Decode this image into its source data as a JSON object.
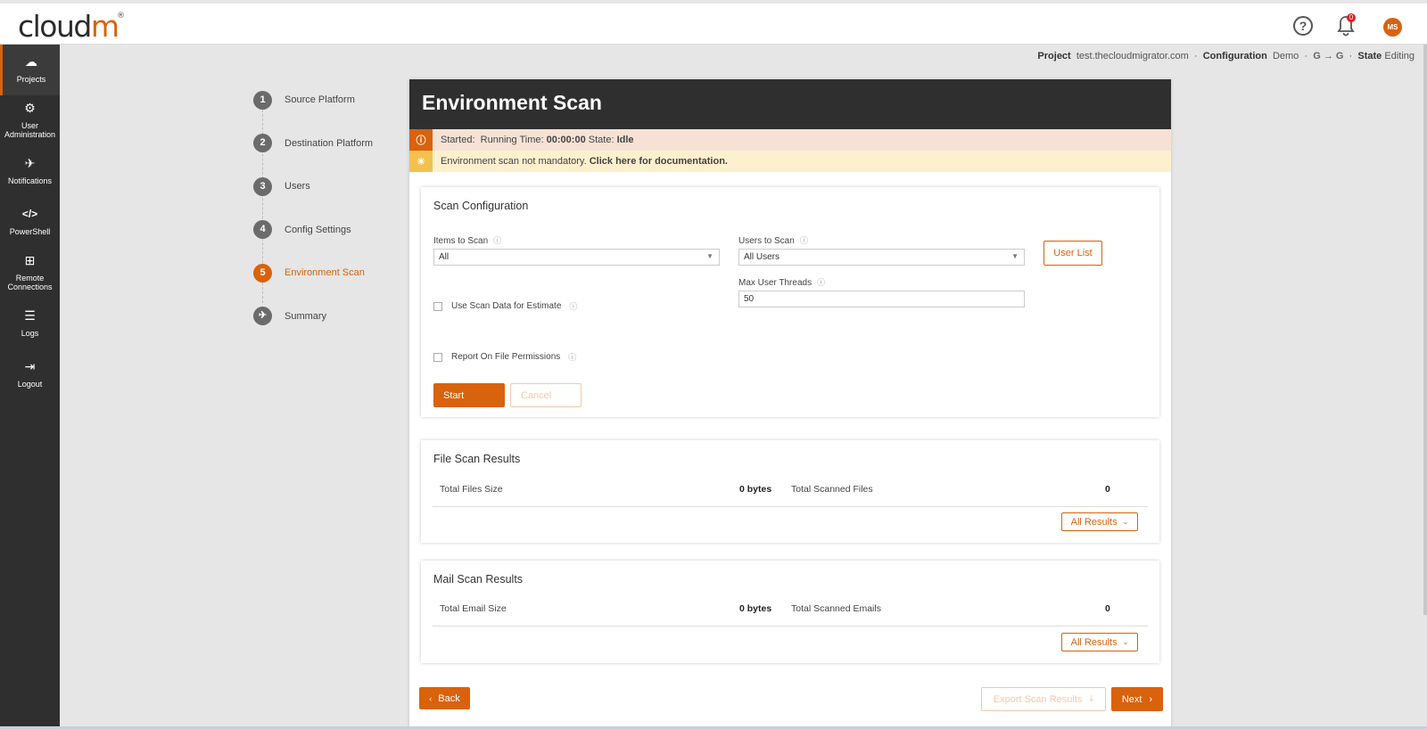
{
  "app": {
    "logo_text": "cloud",
    "logo_accent": "m",
    "logo_reg": "®",
    "avatar_initials": "MS",
    "notification_count": "0",
    "brand_color": "#d9620c"
  },
  "sidebar": {
    "items": [
      {
        "label": "Projects",
        "icon": "cloud-icon",
        "glyph": "☁"
      },
      {
        "label": "User Administration",
        "icon": "gear-icon",
        "glyph": "⚙"
      },
      {
        "label": "Notifications",
        "icon": "paper-plane-icon",
        "glyph": "✈"
      },
      {
        "label": "PowerShell",
        "icon": "code-icon",
        "glyph": "</>"
      },
      {
        "label": "Remote Connections",
        "icon": "sitemap-icon",
        "glyph": "⊞"
      },
      {
        "label": "Logs",
        "icon": "list-icon",
        "glyph": "☰"
      },
      {
        "label": "Logout",
        "icon": "logout-icon",
        "glyph": "⇥"
      }
    ]
  },
  "breadcrumb": {
    "project_label": "Project",
    "project_value": "test.thecloudmigrator.com",
    "config_label": "Configuration",
    "config_value": "Demo",
    "source_platform_icon": "google-icon",
    "dest_platform_icon": "google-icon",
    "arrow": "→",
    "state_label": "State",
    "state_value": "Editing",
    "sep": "·"
  },
  "steps": [
    {
      "num": "1",
      "label": "Source Platform"
    },
    {
      "num": "2",
      "label": "Destination Platform"
    },
    {
      "num": "3",
      "label": "Users"
    },
    {
      "num": "4",
      "label": "Config Settings"
    },
    {
      "num": "5",
      "label": "Environment Scan",
      "active": true
    },
    {
      "num": "",
      "label": "Summary",
      "icon": "paper-plane-icon"
    }
  ],
  "main": {
    "title": "Environment Scan",
    "status": {
      "started_label": "Started:",
      "running_label": "Running Time:",
      "running_value": "00:00:00",
      "state_label": "State:",
      "state_value": "Idle"
    },
    "notice": {
      "text": "Environment scan not mandatory.",
      "link": "Click here for documentation."
    },
    "scan_config": {
      "title": "Scan Configuration",
      "items_label": "Items to Scan",
      "items_value": "All",
      "users_label": "Users to Scan",
      "users_value": "All Users",
      "user_list_button": "User List",
      "threads_label": "Max User Threads",
      "threads_value": "50",
      "use_scan_data": "Use Scan Data for Estimate",
      "report_perms": "Report On File Permissions",
      "start": "Start",
      "cancel": "Cancel"
    },
    "file_results": {
      "title": "File Scan Results",
      "size_label": "Total Files Size",
      "size_value": "0 bytes",
      "count_label": "Total Scanned Files",
      "count_value": "0",
      "button": "All Results"
    },
    "mail_results": {
      "title": "Mail Scan Results",
      "size_label": "Total Email Size",
      "size_value": "0 bytes",
      "count_label": "Total Scanned Emails",
      "count_value": "0",
      "button": "All Results"
    },
    "footer": {
      "back": "Back",
      "export": "Export Scan Results",
      "next": "Next"
    }
  }
}
